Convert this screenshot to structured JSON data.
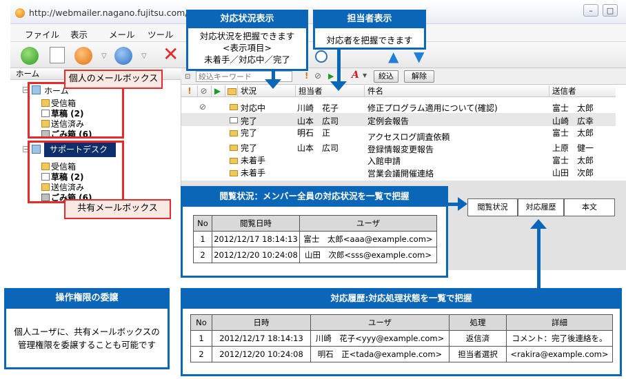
{
  "window": {
    "title": "http://webmailer.nagano.fujitsu.com/ - W",
    "buttons": {
      "minimize": "–",
      "maximize": "□"
    }
  },
  "menu": [
    "ファイル",
    "表示",
    "メール",
    "ツール"
  ],
  "left_pane": {
    "header": "ホーム",
    "home_label": "ホーム",
    "home_items": [
      {
        "label": "受信箱",
        "bold": false
      },
      {
        "label": "草稿 (2)",
        "bold": true
      },
      {
        "label": "送信済み",
        "bold": false
      },
      {
        "label": "ごみ箱 (6)",
        "bold": true
      }
    ],
    "support_label": "サポートデスク",
    "support_items": [
      {
        "label": "受信箱",
        "bold": false
      },
      {
        "label": "草稿 (2)",
        "bold": true
      },
      {
        "label": "送信済み",
        "bold": false
      },
      {
        "label": "ごみ箱 (6)",
        "bold": true
      }
    ]
  },
  "filter": {
    "placeholder": "絞込キーワード",
    "apply_label": "絞込",
    "clear_label": "解除"
  },
  "columns": {
    "status": "状況",
    "assignee": "担当者",
    "subject": "件名",
    "sender": "送信者"
  },
  "mail_rows": [
    {
      "status": "対応中",
      "assignee": "川崎　花子",
      "subject": "修正プログラム適用について(確認)",
      "sender": "富士　太郎"
    },
    {
      "status": "完了",
      "assignee": "山本　広司",
      "subject": "定例会報告",
      "sender": "山崎　広幸"
    },
    {
      "status": "完了",
      "assignee": "明石　正",
      "subject": "アクセスログ調査依頼",
      "sender": "富士　太郎"
    },
    {
      "status": "完了",
      "assignee": "山本　広司",
      "subject": "登録情報変更報告",
      "sender": "上原　健一"
    },
    {
      "status": "未着手",
      "assignee": "",
      "subject": "入館申請",
      "sender": "富士　太郎"
    },
    {
      "status": "未着手",
      "assignee": "",
      "subject": "営業会議開催連絡",
      "sender": "山田　次郎"
    }
  ],
  "preview_tabs": [
    "閲覧状況",
    "対応履歴",
    "本文"
  ],
  "callouts": {
    "status_display": {
      "title": "対応状況表示",
      "lines": [
        "対応状況を把握できます",
        "<表示項目>",
        "未着手／対応中／完了"
      ]
    },
    "assignee_display": {
      "title": "担当者表示",
      "lines": [
        "対応者を把握できます"
      ]
    },
    "personal_mailbox": "個人のメールボックス",
    "shared_mailbox": "共有メールボックス",
    "delegation": {
      "title": "操作権限の委譲",
      "lines": [
        "個人ユーザに、共有メールボックスの",
        "管理権限を委譲することも可能です"
      ]
    }
  },
  "view_status": {
    "title": "閲覧状況：メンバー全員の対応状況を一覧で把握",
    "headers": [
      "No",
      "閲覧日時",
      "ユーザ"
    ],
    "rows": [
      [
        "1",
        "2012/12/17 18:14:13",
        "富士　太郎<aaa@example.com>"
      ],
      [
        "2",
        "2012/12/20 10:24:08",
        "山田　次郎<sss@example.com>"
      ]
    ]
  },
  "history": {
    "title": "対応履歴:対応処理状態を一覧で把握",
    "headers": [
      "No",
      "日時",
      "ユーザ",
      "処理",
      "詳細"
    ],
    "rows": [
      [
        "1",
        "2012/12/17 18:14:13",
        "川崎　花子<yyy@example.com>",
        "返信済",
        "コメント：完了後連絡を。"
      ],
      [
        "2",
        "2012/12/20 10:24:08",
        "明石　正<tada@example.com>",
        "担当者選択",
        "<rakira@example.com>"
      ]
    ]
  },
  "colors": {
    "callout_blue": "#0b66b8",
    "callout_red": "#e8282a",
    "label_fill": "#f9e9e2"
  }
}
